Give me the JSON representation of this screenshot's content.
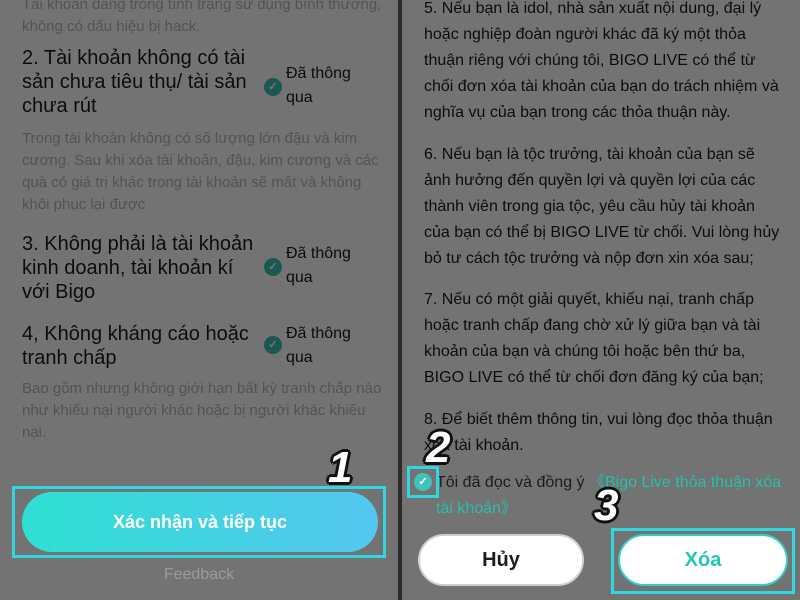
{
  "left": {
    "top_cut": "Tài khoản đang trong tình trạng sử dụng bình thường, không có dấu hiệu bị hack.",
    "conditions": [
      {
        "title": "2. Tài khoản không có tài sản chưa tiêu thụ/ tài sản chưa rút",
        "status": "Đã thông qua",
        "desc": "Trong tài khoản không có số lượng lớn đậu và kim cương. Sau khi xóa tài khoản, đậu, kim cương và các quà có giá trị khác trong tài khoản sẽ mất và không khôi phục lại được"
      },
      {
        "title": "3. Không phải là tài khoản kinh doanh, tài khoản kí với Bigo",
        "status": "Đã thông qua"
      },
      {
        "title": "4, Không kháng cáo hoặc tranh chấp",
        "status": "Đã thông qua",
        "desc": "Bao gồm nhưng không giới hạn bất kỳ tranh chấp nào như khiếu nại người khác hoặc bị người khác khiếu nại."
      }
    ],
    "confirm_label": "Xác nhận và tiếp tục",
    "feedback_label": "Feedback"
  },
  "right": {
    "paragraphs": [
      "5. Nếu bạn là idol, nhà sản xuất nội dung, đại lý hoặc nghiệp đoàn người khác đã ký một thỏa thuận riêng với chúng tôi, BIGO LIVE có thể từ chối đơn xóa tài khoản của bạn do trách nhiệm và nghĩa vụ của bạn trong các thỏa thuận này.",
      "6. Nếu bạn là tộc trưởng, tài khoản của bạn sẽ ảnh hưởng đến quyền lợi và quyền lợi của các thành viên trong gia tộc, yêu cầu hủy tài khoản của bạn có thể bị BIGO LIVE từ chối. Vui lòng hủy bỏ tư cách tộc trưởng và nộp đơn xin xóa sau;",
      "7. Nếu có một giải quyết, khiếu nại, tranh chấp hoặc tranh chấp đang chờ xử lý giữa bạn và tài khoản của bạn và chúng tôi hoặc bên thứ ba, BIGO LIVE có thể từ chối đơn đăng ký của bạn;",
      "8. Để biết thêm thông tin, vui lòng đọc thỏa thuận xóa tài khoản."
    ],
    "agree_text": "Tôi đã đọc và đồng ý",
    "agree_link": "《Bigo Live thỏa thuận xóa tài khoản》",
    "cancel_label": "Hủy",
    "delete_label": "Xóa"
  },
  "steps": [
    "1",
    "2",
    "3"
  ],
  "colors": {
    "accent": "#2fd1c6",
    "highlight": "#30d7e0",
    "gradient_start": "#2ee0d2",
    "gradient_end": "#55c6f0"
  },
  "icons": {
    "check": "check-circle-icon"
  }
}
